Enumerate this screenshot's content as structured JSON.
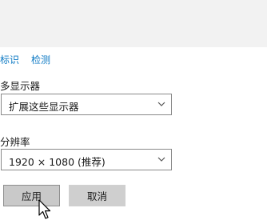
{
  "links": {
    "identify": "标识",
    "detect": "检测"
  },
  "multi_display": {
    "label": "多显示器",
    "selected": "扩展这些显示器"
  },
  "resolution": {
    "label": "分辨率",
    "selected": "1920 × 1080 (推荐)"
  },
  "buttons": {
    "apply": "应用",
    "cancel": "取消"
  },
  "icons": {
    "dropdown": "chevron-down-icon",
    "pointer": "mouse-cursor-icon"
  }
}
